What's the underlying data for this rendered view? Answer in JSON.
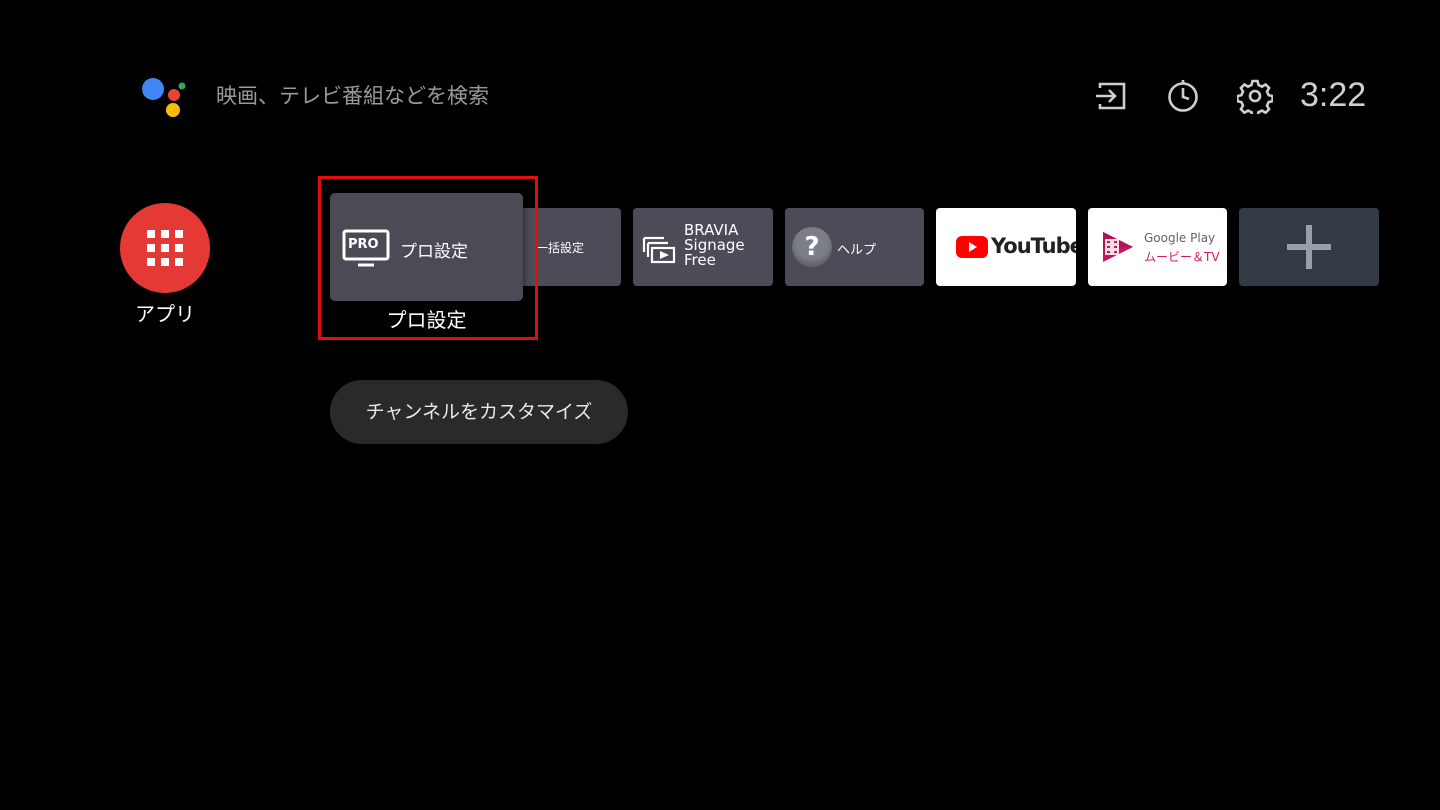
{
  "search": {
    "hint": "映画、テレビ番組などを検索"
  },
  "status_bar": {
    "icons": [
      "input-icon",
      "timer-icon",
      "settings-icon"
    ],
    "time": "3:22"
  },
  "apps_button": {
    "label": "アプリ",
    "icon": "grid-icon",
    "color": "#e53935"
  },
  "tiles": {
    "pro": {
      "badge": "PRO",
      "label": "プロ設定",
      "focused_title": "プロ設定"
    },
    "ikkatsu": {
      "label": "一括設定"
    },
    "bravia": {
      "line1": "BRAVIA",
      "line2": "Signage",
      "line3": "Free"
    },
    "help": {
      "label": "ヘルプ",
      "glyph": "?"
    },
    "youtube": {
      "label": "YouTube"
    },
    "google_play": {
      "line1": "Google Play",
      "line2": "ムービー＆TV"
    },
    "add": {
      "icon": "plus-icon"
    }
  },
  "customize": {
    "label": "チャンネルをカスタマイズ"
  },
  "colors": {
    "focus_highlight": "#e01010",
    "tile": "#4b4c57",
    "accent_red": "#e53935"
  }
}
